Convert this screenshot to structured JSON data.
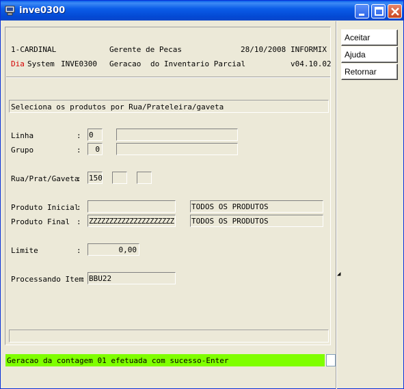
{
  "window": {
    "title": "inve0300"
  },
  "header": {
    "company": "1-CARDINAL",
    "module": "Gerente de Pecas",
    "date": "28/10/2008",
    "db": "INFORMIX",
    "dia": "Dia",
    "system": "System",
    "program": "INVE0300",
    "geracao": "Geracao",
    "description": "do Inventario Parcial",
    "version": "v04.10.02"
  },
  "form": {
    "subtitle": "Seleciona os produtos por Rua/Prateleira/gaveta",
    "linha_label": "Linha",
    "linha_value": "0",
    "linha_desc": "",
    "grupo_label": "Grupo",
    "grupo_value": "0",
    "grupo_desc": "",
    "rua_label": "Rua/Prat/Gaveta",
    "rua_value": "150",
    "prat_value": "",
    "gaveta_value": "",
    "prod_ini_label": "Produto Inicial",
    "prod_ini_value": "",
    "prod_ini_desc": "TODOS OS PRODUTOS",
    "prod_fin_label": "Produto Final",
    "prod_fin_value": "ZZZZZZZZZZZZZZZZZZZZZ",
    "prod_fin_desc": "TODOS OS PRODUTOS",
    "limite_label": "Limite",
    "limite_value": "0,00",
    "proc_label": "Processando Item",
    "proc_value": "BBU22",
    "colon": ":"
  },
  "status": {
    "message": "Geracao da contagem 01 efetuada com sucesso-Enter",
    "color": "#7fff00"
  },
  "side_buttons": {
    "aceitar": "Aceitar",
    "ajuda": "Ajuda",
    "retornar": "Retornar"
  },
  "icons": [
    "app-icon",
    "minimize-icon",
    "maximize-icon",
    "close-icon"
  ]
}
